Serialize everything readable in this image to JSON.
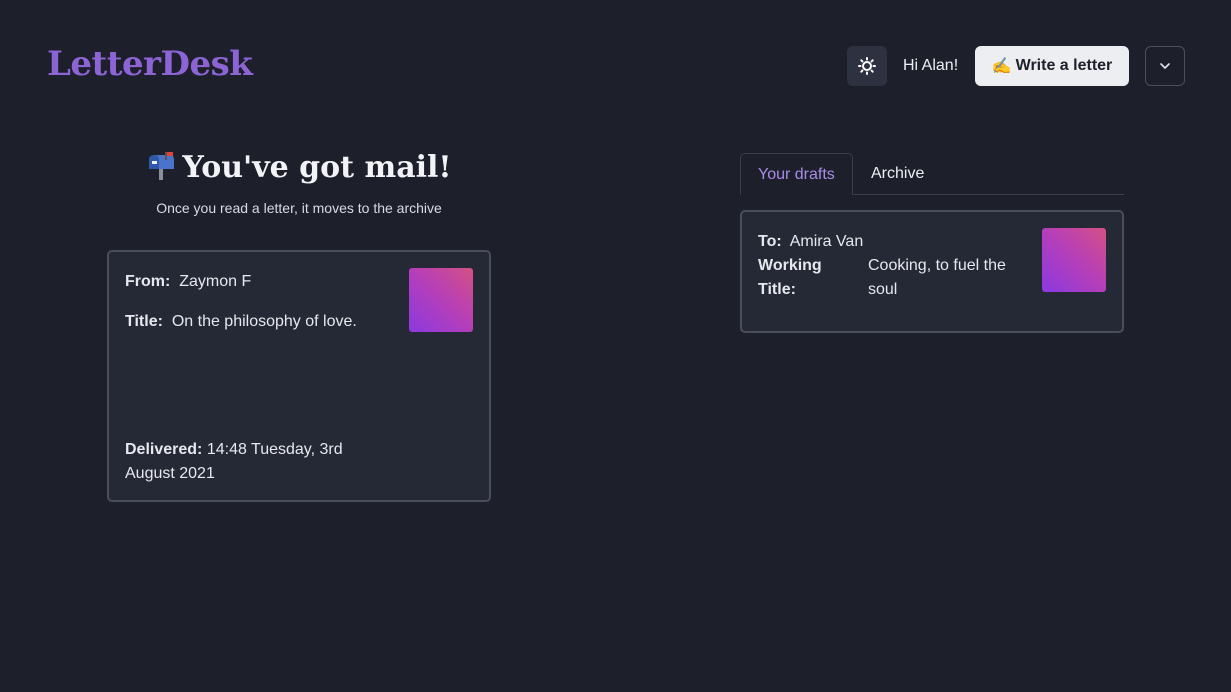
{
  "header": {
    "logo": "LetterDesk",
    "greeting": "Hi Alan!",
    "write_button": "Write a letter",
    "write_button_emoji": "✍️",
    "theme_icon": "sun-icon",
    "menu_icon": "chevron-down-icon"
  },
  "inbox": {
    "title": "You've got mail!",
    "title_icon": "mailbox-icon",
    "subtitle": "Once you read a letter, it moves to the archive",
    "letters": [
      {
        "from_label": "From:",
        "from": "Zaymon F",
        "title_label": "Title:",
        "title": "On the philosophy of love.",
        "delivered_label": "Delivered:",
        "delivered_line1": "14:48 Tuesday, 3rd",
        "delivered_line2": "August 2021"
      }
    ]
  },
  "drafts": {
    "tabs": [
      {
        "label": "Your drafts",
        "active": true
      },
      {
        "label": "Archive",
        "active": false
      }
    ],
    "items": [
      {
        "to_label": "To:",
        "to": "Amira Van",
        "title_label_line1": "Working",
        "title_label_line2": "Title:",
        "title_line1": "Cooking, to fuel the",
        "title_line2": "soul"
      }
    ]
  },
  "colors": {
    "background": "#1d202b",
    "card": "#252935",
    "accent": "#8c64d6",
    "tab_active": "#a98ce6",
    "thumb_gradient_start": "#8b39e0",
    "thumb_gradient_end": "#d45185"
  }
}
